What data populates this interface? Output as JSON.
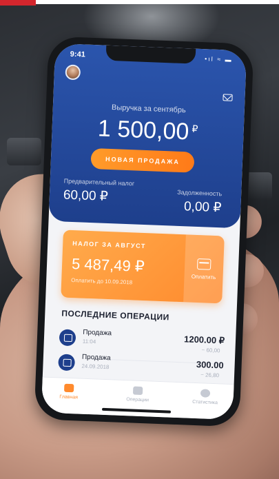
{
  "status": {
    "time": "9:41",
    "icons": "•ıl ≈ ▬"
  },
  "header": {
    "revenue_label": "Выручка за сентябрь",
    "revenue_value": "1 500,00",
    "currency": "₽",
    "new_sale_label": "НОВАЯ ПРОДАЖА",
    "pre_tax_label": "Предварительный налог",
    "pre_tax_value": "60,00 ₽",
    "debt_label": "Задолженность",
    "debt_value": "0,00 ₽"
  },
  "tax_card": {
    "title": "НАЛОГ ЗА АВГУСТ",
    "value": "5 487,49 ₽",
    "due": "Оплатить до 10.09.2018",
    "pay_label": "Оплатить"
  },
  "operations": {
    "title": "ПОСЛЕДНИЕ ОПЕРАЦИИ",
    "items": [
      {
        "name": "Продажа",
        "time": "11:04",
        "amount": "1200.00 ₽",
        "fee": "− 60,00"
      },
      {
        "name": "Продажа",
        "time": "24.09.2018",
        "amount": "300.00",
        "fee": "− 26,80"
      }
    ]
  },
  "tabs": [
    {
      "label": "Главная",
      "icon": "briefcase-icon",
      "active": true
    },
    {
      "label": "Операции",
      "icon": "wallet-icon",
      "active": false
    },
    {
      "label": "Статистика",
      "icon": "pie-chart-icon",
      "active": false
    }
  ],
  "colors": {
    "brand_blue": "#1e3f8c",
    "accent_orange": "#ff8a2d",
    "corner_red": "#d3262d"
  }
}
